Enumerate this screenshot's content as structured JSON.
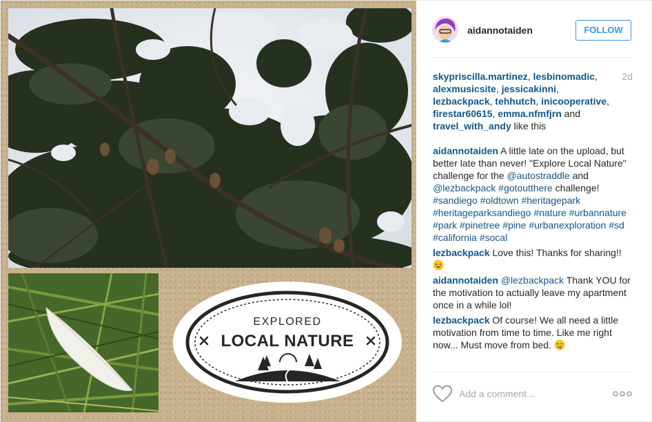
{
  "post": {
    "author": "aidannotaiden",
    "follow_label": "FOLLOW",
    "age": "2d",
    "image": {
      "badge_line1": "EXPLORED",
      "badge_line2": "LOCAL NATURE"
    }
  },
  "likes": {
    "users": [
      "skypriscilla.martinez",
      "lesbinomadic",
      "alexmusicsite",
      "jessicakinni",
      "lezbackpack",
      "tehhutch",
      "inicooperative",
      "firestar60615",
      "emma.nfmfjrn",
      "travel_with_andy"
    ],
    "sep": ", ",
    "and_word": " and ",
    "suffix": " like this"
  },
  "comments": [
    {
      "author": "aidannotaiden",
      "parts": [
        {
          "t": " A little late on the upload, but better late than never! \"Explore Local Nature\" challenge for the "
        },
        {
          "tag": "@autostraddle"
        },
        {
          "t": " and "
        },
        {
          "tag": "@lezbackpack"
        },
        {
          "t": " "
        },
        {
          "tag": "#gotoutthere"
        },
        {
          "t": " challenge! "
        },
        {
          "tag": "#sandiego"
        },
        {
          "t": " "
        },
        {
          "tag": "#oldtown"
        },
        {
          "t": " "
        },
        {
          "tag": "#heritagepark"
        },
        {
          "t": " "
        },
        {
          "tag": "#heritageparksandiego"
        },
        {
          "t": " "
        },
        {
          "tag": "#nature"
        },
        {
          "t": " "
        },
        {
          "tag": "#urbannature"
        },
        {
          "t": " "
        },
        {
          "tag": "#park"
        },
        {
          "t": " "
        },
        {
          "tag": "#pinetree"
        },
        {
          "t": " "
        },
        {
          "tag": "#pine"
        },
        {
          "t": " "
        },
        {
          "tag": "#urbanexploration"
        },
        {
          "t": " "
        },
        {
          "tag": "#sd"
        },
        {
          "t": " "
        },
        {
          "tag": "#california"
        },
        {
          "t": " "
        },
        {
          "tag": "#socal"
        }
      ]
    },
    {
      "author": "lezbackpack",
      "parts": [
        {
          "t": " Love this! Thanks for sharing!! "
        },
        {
          "emoji": "laughing-emoji"
        }
      ]
    },
    {
      "author": "aidannotaiden",
      "parts": [
        {
          "t": " "
        },
        {
          "tag": "@lezbackpack"
        },
        {
          "t": " Thank YOU for the motivation to actually leave my apartment once in a while lol!"
        }
      ]
    },
    {
      "author": "lezbackpack",
      "parts": [
        {
          "t": " Of course! We all need a little motivation from time to time. Like me right now... Must move from bed. "
        },
        {
          "emoji": "silly-face-emoji"
        }
      ]
    }
  ],
  "footer": {
    "like_icon": "heart-icon",
    "comment_placeholder": "Add a comment...",
    "more_icon": "more-options-icon"
  },
  "colors": {
    "link": "#125688",
    "follow": "#3897f0",
    "muted": "#a5a7aa"
  }
}
